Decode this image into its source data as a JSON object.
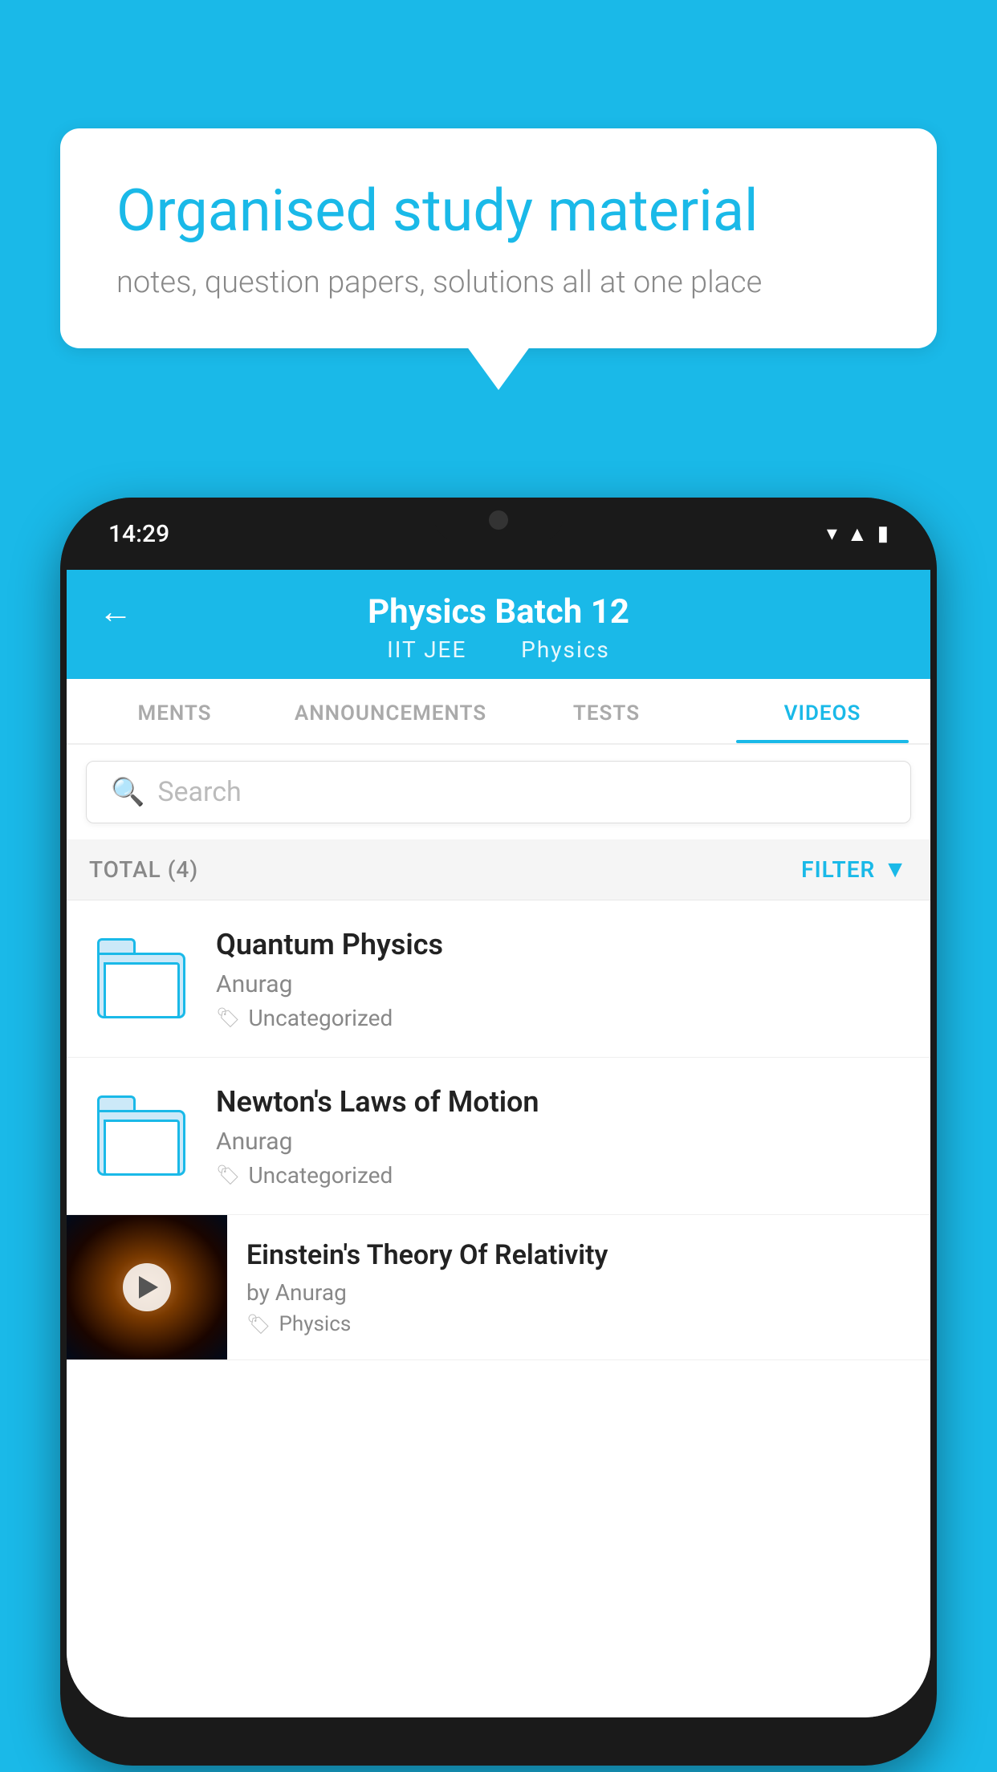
{
  "background_color": "#1ab9e8",
  "speech_bubble": {
    "title": "Organised study material",
    "subtitle": "notes, question papers, solutions all at one place"
  },
  "phone": {
    "status_bar": {
      "time": "14:29"
    },
    "header": {
      "back_label": "←",
      "title": "Physics Batch 12",
      "subtitle_part1": "IIT JEE",
      "subtitle_part2": "Physics"
    },
    "tabs": [
      {
        "label": "MENTS",
        "active": false
      },
      {
        "label": "ANNOUNCEMENTS",
        "active": false
      },
      {
        "label": "TESTS",
        "active": false
      },
      {
        "label": "VIDEOS",
        "active": true
      }
    ],
    "search": {
      "placeholder": "Search"
    },
    "filter_row": {
      "total_label": "TOTAL (4)",
      "filter_label": "FILTER"
    },
    "videos": [
      {
        "id": "quantum",
        "title": "Quantum Physics",
        "author": "Anurag",
        "tag": "Uncategorized",
        "type": "folder"
      },
      {
        "id": "newton",
        "title": "Newton's Laws of Motion",
        "author": "Anurag",
        "tag": "Uncategorized",
        "type": "folder"
      },
      {
        "id": "einstein",
        "title": "Einstein's Theory Of Relativity",
        "author": "by Anurag",
        "tag": "Physics",
        "type": "video"
      }
    ]
  }
}
